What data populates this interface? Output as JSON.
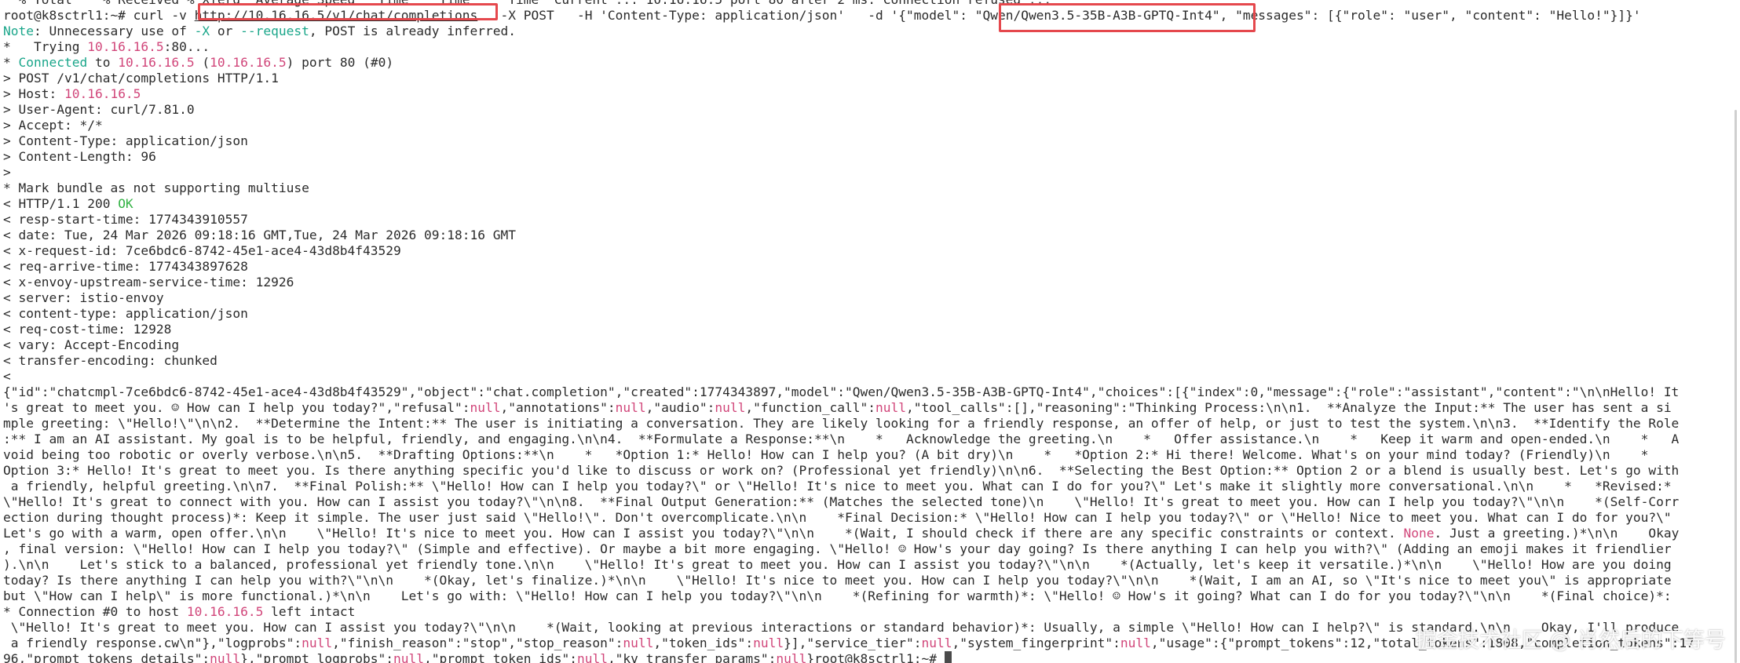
{
  "colors": {
    "default_text": "#2b2b2b",
    "teal": "#1aa68a",
    "pink": "#d1467a",
    "green": "#33b244",
    "highlight_box": "#e5484d",
    "background": "#ffffff"
  },
  "terminal": {
    "lines": [
      {
        "segs": [
          {
            "t": "  % Total    % Received % Xferd  Average Speed   Time    Time     Time  Current ... 10.16.16.5 port 80 after 2 ms: Connection refused ...",
            "c": "def"
          }
        ]
      },
      {
        "segs": [
          {
            "t": "root@k8sctrl1:~# curl -v ",
            "c": "def"
          },
          {
            "t": "http://10.16.16.5/v1/chat/completions",
            "c": "link"
          },
          {
            "t": "   -X POST   -H 'Content-Type: application/json'   -d '{\"model\": \"Qwen/Qwen3.5-35B-A3B-GPTQ-Int4\", \"messages\": [{\"role\": \"user\", \"content\": \"Hello!\"}]}'",
            "c": "def"
          }
        ]
      },
      {
        "segs": [
          {
            "t": "Note",
            "c": "teal"
          },
          {
            "t": ": Unnecessary use of ",
            "c": "def"
          },
          {
            "t": "-X",
            "c": "teal"
          },
          {
            "t": " or ",
            "c": "def"
          },
          {
            "t": "--request",
            "c": "teal"
          },
          {
            "t": ", POST is already inferred.",
            "c": "def"
          }
        ]
      },
      {
        "segs": [
          {
            "t": "*   Trying ",
            "c": "def"
          },
          {
            "t": "10.16.16.5",
            "c": "pink"
          },
          {
            "t": ":80...",
            "c": "def"
          }
        ]
      },
      {
        "segs": [
          {
            "t": "* ",
            "c": "def"
          },
          {
            "t": "Connected",
            "c": "teal"
          },
          {
            "t": " to ",
            "c": "def"
          },
          {
            "t": "10.16.16.5",
            "c": "pink"
          },
          {
            "t": " (",
            "c": "def"
          },
          {
            "t": "10.16.16.5",
            "c": "pink"
          },
          {
            "t": ") port 80 (#0)",
            "c": "def"
          }
        ]
      },
      {
        "segs": [
          {
            "t": "> POST /v1/chat/completions HTTP/1.1",
            "c": "def"
          }
        ]
      },
      {
        "segs": [
          {
            "t": "> Host: ",
            "c": "def"
          },
          {
            "t": "10.16.16.5",
            "c": "pink"
          }
        ]
      },
      {
        "segs": [
          {
            "t": "> User-Agent: curl/7.81.0",
            "c": "def"
          }
        ]
      },
      {
        "segs": [
          {
            "t": "> Accept: */*",
            "c": "def"
          }
        ]
      },
      {
        "segs": [
          {
            "t": "> Content-Type: application/json",
            "c": "def"
          }
        ]
      },
      {
        "segs": [
          {
            "t": "> Content-Length: 96",
            "c": "def"
          }
        ]
      },
      {
        "segs": [
          {
            "t": ">",
            "c": "def"
          }
        ]
      },
      {
        "segs": [
          {
            "t": "* Mark bundle as not supporting multiuse",
            "c": "def"
          }
        ]
      },
      {
        "segs": [
          {
            "t": "< HTTP/1.1 200 ",
            "c": "def"
          },
          {
            "t": "OK",
            "c": "green"
          }
        ]
      },
      {
        "segs": [
          {
            "t": "< resp-start-time: 1774343910557",
            "c": "def"
          }
        ]
      },
      {
        "segs": [
          {
            "t": "< date: Tue, 24 Mar 2026 09:18:16 GMT,Tue, 24 Mar 2026 09:18:16 GMT",
            "c": "def"
          }
        ]
      },
      {
        "segs": [
          {
            "t": "< x-request-id: 7ce6bdc6-8742-45e1-ace4-43d8b4f43529",
            "c": "def"
          }
        ]
      },
      {
        "segs": [
          {
            "t": "< req-arrive-time: 1774343897628",
            "c": "def"
          }
        ]
      },
      {
        "segs": [
          {
            "t": "< x-envoy-upstream-service-time: 12926",
            "c": "def"
          }
        ]
      },
      {
        "segs": [
          {
            "t": "< server: istio-envoy",
            "c": "def"
          }
        ]
      },
      {
        "segs": [
          {
            "t": "< content-type: application/json",
            "c": "def"
          }
        ]
      },
      {
        "segs": [
          {
            "t": "< req-cost-time: 12928",
            "c": "def"
          }
        ]
      },
      {
        "segs": [
          {
            "t": "< vary: Accept-Encoding",
            "c": "def"
          }
        ]
      },
      {
        "segs": [
          {
            "t": "< transfer-encoding: chunked",
            "c": "def"
          }
        ]
      },
      {
        "segs": [
          {
            "t": "<",
            "c": "def"
          }
        ]
      },
      {
        "segs": [
          {
            "t": "{\"id\":\"chatcmpl-7ce6bdc6-8742-45e1-ace4-43d8b4f43529\",\"object\":\"chat.completion\",\"created\":1774343897,\"model\":\"Qwen/Qwen3.5-35B-A3B-GPTQ-Int4\",\"choices\":[{\"index\":0,\"message\":{\"role\":\"assistant\",\"content\":\"\\n\\nHello! It",
            "c": "def"
          }
        ]
      },
      {
        "segs": [
          {
            "t": "'s great to meet you. ☺ How can I help you today?\",\"refusal\":",
            "c": "def"
          },
          {
            "t": "null",
            "c": "pink"
          },
          {
            "t": ",\"annotations\":",
            "c": "def"
          },
          {
            "t": "null",
            "c": "pink"
          },
          {
            "t": ",\"audio\":",
            "c": "def"
          },
          {
            "t": "null",
            "c": "pink"
          },
          {
            "t": ",\"function_call\":",
            "c": "def"
          },
          {
            "t": "null",
            "c": "pink"
          },
          {
            "t": ",\"tool_calls\":[],\"reasoning\":\"Thinking Process:\\n\\n1.  **Analyze the Input:** The user has sent a si",
            "c": "def"
          }
        ]
      },
      {
        "segs": [
          {
            "t": "mple greeting: \\\"Hello!\\\"\\n\\n2.  **Determine the Intent:** The user is initiating a conversation. They are likely looking for a friendly response, an offer of help, or just to test the system.\\n\\n3.  **Identify the Role",
            "c": "def"
          }
        ]
      },
      {
        "segs": [
          {
            "t": ":** I am an AI assistant. My goal is to be helpful, friendly, and engaging.\\n\\n4.  **Formulate a Response:**\\n    *   Acknowledge the greeting.\\n    *   Offer assistance.\\n    *   Keep it warm and open-ended.\\n    *   A",
            "c": "def"
          }
        ]
      },
      {
        "segs": [
          {
            "t": "void being too robotic or overly verbose.\\n\\n5.  **Drafting Options:**\\n    *   *Option 1:* Hello! How can I help you? (A bit dry)\\n    *   *Option 2:* Hi there! Welcome. What's on your mind today? (Friendly)\\n    *",
            "c": "def"
          }
        ]
      },
      {
        "segs": [
          {
            "t": "Option 3:* Hello! It's great to meet you. Is there anything specific you'd like to discuss or work on? (Professional yet friendly)\\n\\n6.  **Selecting the Best Option:** Option 2 or a blend is usually best. Let's go with",
            "c": "def"
          }
        ]
      },
      {
        "segs": [
          {
            "t": " a friendly, helpful greeting.\\n\\n7.  **Final Polish:** \\\"Hello! How can I help you today?\\\" or \\\"Hello! It's nice to meet you. What can I do for you?\\\" Let's make it slightly more conversational.\\n\\n    *   *Revised:*",
            "c": "def"
          }
        ]
      },
      {
        "segs": [
          {
            "t": "\\\"Hello! It's great to connect with you. How can I assist you today?\\\"\\n\\n8.  **Final Output Generation:** (Matches the selected tone)\\n    \\\"Hello! It's great to meet you. How can I help you today?\\\"\\n\\n    *(Self-Corr",
            "c": "def"
          }
        ]
      },
      {
        "segs": [
          {
            "t": "ection during thought process)*: Keep it simple. The user just said \\\"Hello!\\\". Don't overcomplicate.\\n\\n    *Final Decision:* \\\"Hello! How can I help you today?\\\" or \\\"Hello! Nice to meet you. What can I do for you?\\\"",
            "c": "def"
          }
        ]
      },
      {
        "segs": [
          {
            "t": "Let's go with a warm, open offer.\\n\\n    \\\"Hello! It's nice to meet you. How can I assist you today?\\\"\\n\\n    *(Wait, I should check if there are any specific constraints or context. ",
            "c": "def"
          },
          {
            "t": "None",
            "c": "pink"
          },
          {
            "t": ". Just a greeting.)*\\n\\n    Okay",
            "c": "def"
          }
        ]
      },
      {
        "segs": [
          {
            "t": ", final version: \\\"Hello! How can I help you today?\\\" (Simple and effective). Or maybe a bit more engaging. \\\"Hello! ☺ How's your day going? Is there anything I can help you with?\\\" (Adding an emoji makes it friendlier",
            "c": "def"
          }
        ]
      },
      {
        "segs": [
          {
            "t": ").\\n\\n    Let's stick to a balanced, professional yet friendly tone.\\n\\n    \\\"Hello! It's great to meet you. How can I assist you today?\\\"\\n\\n    *(Actually, let's keep it versatile.)*\\n\\n    \\\"Hello! How are you doing",
            "c": "def"
          }
        ]
      },
      {
        "segs": [
          {
            "t": "today? Is there anything I can help you with?\\\"\\n\\n    *(Okay, let's finalize.)*\\n\\n    \\\"Hello! It's nice to meet you. How can I help you today?\\\"\\n\\n    *(Wait, I am an AI, so \\\"It's nice to meet you\\\" is appropriate",
            "c": "def"
          }
        ]
      },
      {
        "segs": [
          {
            "t": "but \\\"How can I help\\\" is more functional.)*\\n\\n    Let's go with: \\\"Hello! How can I help you today?\\\"\\n\\n    *(Refining for warmth)*: \\\"Hello! ☺ How's it going? What can I do for you today?\\\"\\n\\n    *(Final choice)*:",
            "c": "def"
          }
        ]
      },
      {
        "segs": [
          {
            "t": "* Connection #0 to host ",
            "c": "def"
          },
          {
            "t": "10.16.16.5",
            "c": "pink"
          },
          {
            "t": " left intact",
            "c": "def"
          }
        ]
      },
      {
        "segs": [
          {
            "t": " \\\"Hello! It's great to meet you. How can I assist you today?\\\"\\n\\n    *(Wait, looking at previous interactions or standard behavior)*: Usually, a simple \\\"Hello! How can I help?\\\" is standard.\\n\\n    Okay, I'll produce",
            "c": "def"
          }
        ]
      },
      {
        "segs": [
          {
            "t": " a friendly response.cw\\n\"},\"logprobs\":",
            "c": "def"
          },
          {
            "t": "null",
            "c": "pink"
          },
          {
            "t": ",\"finish_reason\":\"stop\",\"stop_reason\":",
            "c": "def"
          },
          {
            "t": "null",
            "c": "pink"
          },
          {
            "t": ",\"token_ids\":",
            "c": "def"
          },
          {
            "t": "null",
            "c": "pink"
          },
          {
            "t": "}],\"service_tier\":",
            "c": "def"
          },
          {
            "t": "null",
            "c": "pink"
          },
          {
            "t": ",\"system_fingerprint\":",
            "c": "def"
          },
          {
            "t": "null",
            "c": "pink"
          },
          {
            "t": ",\"usage\":{\"prompt_tokens\":12,\"total_tokens\":1808,\"completion_tokens\":17",
            "c": "def"
          }
        ]
      },
      {
        "segs": [
          {
            "t": "96,\"prompt_tokens_details\":",
            "c": "def"
          },
          {
            "t": "null",
            "c": "pink"
          },
          {
            "t": "},\"prompt_logprobs\":",
            "c": "def"
          },
          {
            "t": "null",
            "c": "pink"
          },
          {
            "t": ",\"prompt_token_ids\":",
            "c": "def"
          },
          {
            "t": "null",
            "c": "pink"
          },
          {
            "t": ",\"kv_transfer_params\":",
            "c": "def"
          },
          {
            "t": "null",
            "c": "pink"
          },
          {
            "t": "}root@k8sctrl1:~# ",
            "c": "def"
          }
        ]
      }
    ]
  },
  "watermark": {
    "text": "掘金技术社区 @ 肖然后的下等号"
  }
}
